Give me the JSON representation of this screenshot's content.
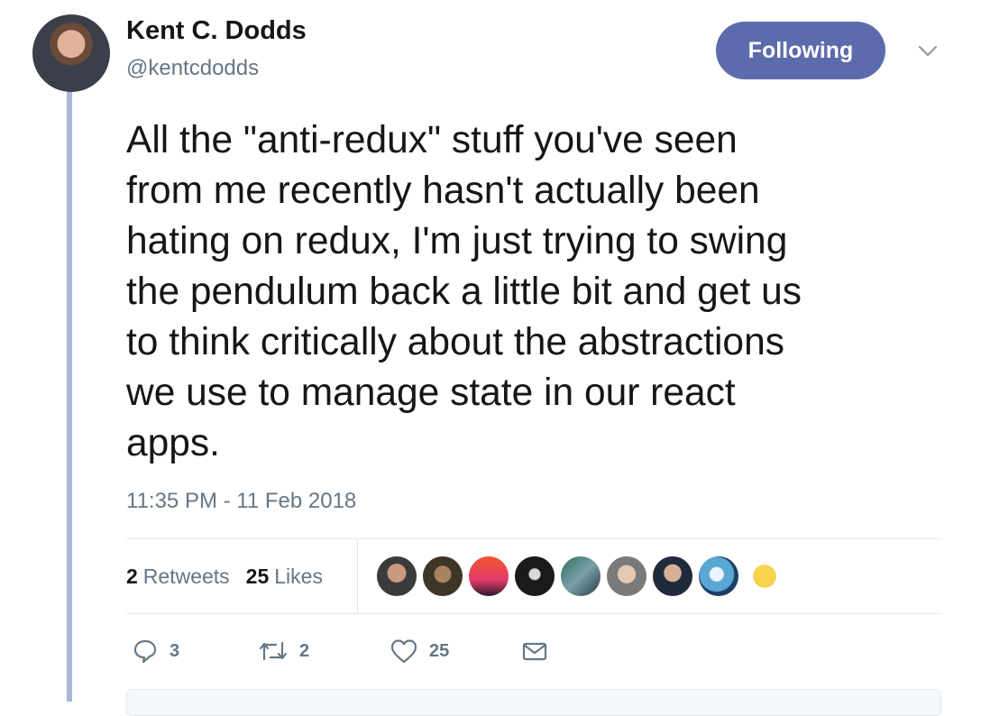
{
  "author": {
    "name": "Kent C. Dodds",
    "handle": "@kentcdodds"
  },
  "follow_button": {
    "label": "Following"
  },
  "tweet": {
    "text_lines": [
      "All the \"anti-redux\" stuff you've seen",
      "from me recently hasn't actually been",
      "hating on redux, I'm just trying to swing",
      "the pendulum back a little bit and get us",
      "to think critically about the abstractions",
      "we use to manage state in our react",
      "apps."
    ],
    "timestamp": "11:35 PM - 11 Feb 2018"
  },
  "stats": {
    "retweets_count": "2",
    "retweets_label": "Retweets",
    "likes_count": "25",
    "likes_label": "Likes"
  },
  "actions": {
    "reply_count": "3",
    "retweet_count": "2",
    "like_count": "25"
  },
  "icons": {
    "reply": "speech-bubble-icon",
    "retweet": "retweet-arrows-icon",
    "like": "heart-icon",
    "message": "envelope-icon",
    "more": "chevron-down-icon"
  },
  "colors": {
    "follow_button_bg": "#5c6bab",
    "thread_line": "#a9b6d6",
    "secondary_text": "#657786"
  }
}
